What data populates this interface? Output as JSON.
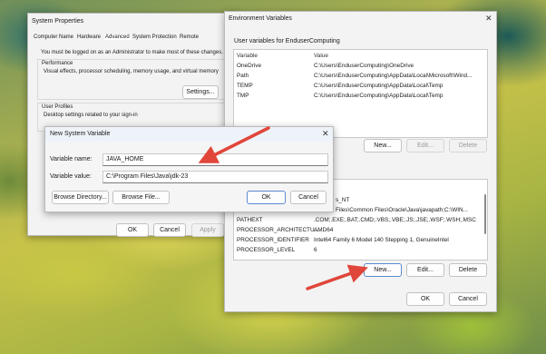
{
  "system_properties": {
    "title": "System Properties",
    "tabs": [
      "Computer Name",
      "Hardware",
      "Advanced",
      "System Protection",
      "Remote"
    ],
    "active_tab": "Advanced",
    "admin_notice": "You must be logged on as an Administrator to make most of these changes.",
    "performance_title": "Performance",
    "performance_desc": "Visual effects, processor scheduling, memory usage, and virtual memory",
    "settings_button": "Settings...",
    "user_profiles_title": "User Profiles",
    "user_profiles_desc": "Desktop settings related to your sign-in",
    "ok": "OK",
    "cancel": "Cancel",
    "apply": "Apply"
  },
  "env_vars": {
    "title": "Environment Variables",
    "user_section_title": "User variables for EnduserComputing",
    "col_variable": "Variable",
    "col_value": "Value",
    "user_rows": [
      {
        "variable": "OneDrive",
        "value": "C:\\Users\\EnduserComputing\\OneDrive"
      },
      {
        "variable": "Path",
        "value": "C:\\Users\\EnduserComputing\\AppData\\Local\\Microsoft\\Wind..."
      },
      {
        "variable": "TEMP",
        "value": "C:\\Users\\EnduserComputing\\AppData\\Local\\Temp"
      },
      {
        "variable": "TMP",
        "value": "C:\\Users\\EnduserComputing\\AppData\\Local\\Temp"
      }
    ],
    "user_buttons": {
      "new": "New...",
      "edit": "Edit...",
      "delete": "Delete"
    },
    "system_rows": [
      {
        "variable": "",
        "value": "s_NT"
      },
      {
        "variable": "",
        "value": "Files\\Common Files\\Oracle\\Java\\javapath;C:\\WIN..."
      },
      {
        "variable": "PATHEXT",
        "value": ".COM;.EXE;.BAT;.CMD;.VBS;.VBE;.JS;.JSE;.WSF;.WSH;.MSC"
      },
      {
        "variable": "PROCESSOR_ARCHITECTU...",
        "value": "AMD64"
      },
      {
        "variable": "PROCESSOR_IDENTIFIER",
        "value": "Intel64 Family 6 Model 140 Stepping 1, GenuineIntel"
      },
      {
        "variable": "PROCESSOR_LEVEL",
        "value": "6"
      }
    ],
    "system_buttons": {
      "new": "New...",
      "edit": "Edit...",
      "delete": "Delete"
    },
    "ok": "OK",
    "cancel": "Cancel"
  },
  "new_var_dialog": {
    "title": "New System Variable",
    "name_label": "Variable name:",
    "name_value": "JAVA_HOME",
    "value_label": "Variable value:",
    "value_value": "C:\\Program Files\\Java\\jdk-23",
    "browse_directory": "Browse Directory...",
    "browse_file": "Browse File...",
    "ok": "OK",
    "cancel": "Cancel"
  },
  "colors": {
    "arrow": "#e0463a",
    "selection_border": "#5b8ad0",
    "dialog_header": "#eef3fa"
  }
}
